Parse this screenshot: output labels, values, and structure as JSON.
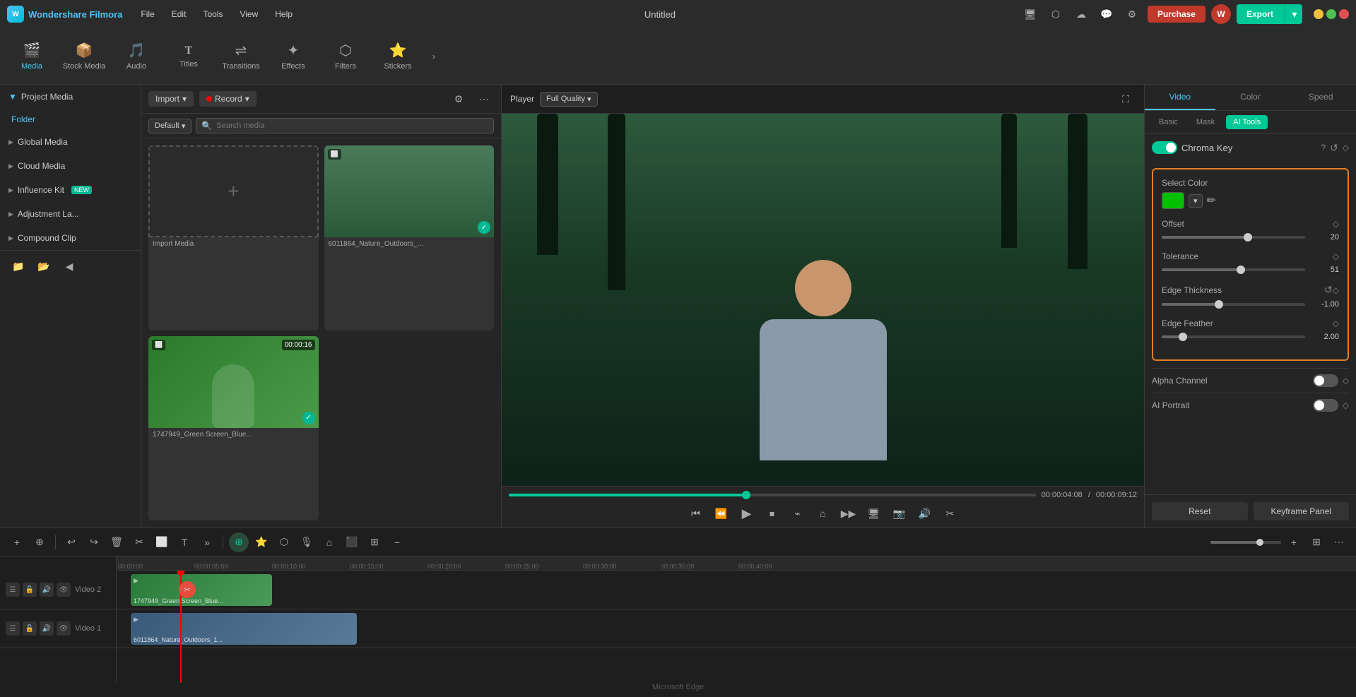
{
  "app": {
    "name": "Wondershare Filmora",
    "title": "Untitled"
  },
  "titlebar": {
    "menu": [
      "File",
      "Edit",
      "Tools",
      "View",
      "Help"
    ],
    "purchase_label": "Purchase",
    "export_label": "Export",
    "avatar_initials": "W"
  },
  "toolbar": {
    "items": [
      {
        "id": "media",
        "label": "Media",
        "icon": "🎬"
      },
      {
        "id": "stock",
        "label": "Stock Media",
        "icon": "📦"
      },
      {
        "id": "audio",
        "label": "Audio",
        "icon": "🎵"
      },
      {
        "id": "titles",
        "label": "Titles",
        "icon": "T"
      },
      {
        "id": "transitions",
        "label": "Transitions",
        "icon": "↔"
      },
      {
        "id": "effects",
        "label": "Effects",
        "icon": "✦"
      },
      {
        "id": "filters",
        "label": "Filters",
        "icon": "⬡"
      },
      {
        "id": "stickers",
        "label": "Stickers",
        "icon": "⭐"
      }
    ]
  },
  "sidebar": {
    "items": [
      {
        "id": "project-media",
        "label": "Project Media",
        "has_chevron": true
      },
      {
        "id": "folder",
        "label": "Folder",
        "type": "folder"
      },
      {
        "id": "global-media",
        "label": "Global Media",
        "has_chevron": true
      },
      {
        "id": "cloud-media",
        "label": "Cloud Media",
        "has_chevron": true
      },
      {
        "id": "influence-kit",
        "label": "Influence Kit",
        "badge": "NEW",
        "has_chevron": true
      },
      {
        "id": "adjustment-layer",
        "label": "Adjustment La...",
        "has_chevron": true
      },
      {
        "id": "compound-clip",
        "label": "Compound Clip",
        "has_chevron": true
      }
    ]
  },
  "media_panel": {
    "import_label": "Import",
    "record_label": "Record",
    "default_label": "Default",
    "search_placeholder": "Search media",
    "items": [
      {
        "id": "import-media",
        "label": "Import Media",
        "type": "add"
      },
      {
        "id": "nature",
        "label": "6011864_Nature_Outdoors_...",
        "type": "nature",
        "checked": true
      },
      {
        "id": "green-screen",
        "label": "1747949_Green Screen_Blue...",
        "type": "green-screen",
        "duration": "00:00:16",
        "checked": true
      }
    ]
  },
  "player": {
    "label": "Player",
    "quality": "Full Quality",
    "time_current": "00:00:04:08",
    "time_total": "00:00:09:12",
    "progress_pct": 45
  },
  "right_panel": {
    "tabs": [
      "Video",
      "Color",
      "Speed"
    ],
    "active_tab": "Video",
    "sub_tabs": [
      "Basic",
      "Mask",
      "AI Tools"
    ],
    "active_sub_tab": "AI Tools",
    "chroma_key": {
      "label": "Chroma Key",
      "enabled": true
    },
    "select_color": {
      "label": "Select Color",
      "color": "#00c000"
    },
    "offset": {
      "label": "Offset",
      "value": "20",
      "pct": 60
    },
    "tolerance": {
      "label": "Tolerance",
      "value": "51",
      "pct": 55
    },
    "edge_thickness": {
      "label": "Edge Thickness",
      "value": "-1.00",
      "pct": 40
    },
    "edge_feather": {
      "label": "Edge Feather",
      "value": "2.00",
      "pct": 15
    },
    "alpha_channel": {
      "label": "Alpha Channel",
      "enabled": false
    },
    "ai_portrait": {
      "label": "AI Portrait",
      "enabled": false
    },
    "reset_label": "Reset",
    "keyframe_panel_label": "Keyframe Panel"
  },
  "timeline": {
    "tracks": [
      {
        "id": "video2",
        "label": "Video 2"
      },
      {
        "id": "video1",
        "label": "Video 1"
      }
    ],
    "clips": [
      {
        "track": 0,
        "label": "1747949_Green Screen_Blue...",
        "file": "🎬"
      },
      {
        "track": 1,
        "label": "6011864_Nature_Outdoors_1...",
        "file": "🎬"
      }
    ],
    "markers": [
      "00:00:00",
      "00:00:05:00",
      "00:00:10:00",
      "00:00:15:00",
      "00:00:20:00",
      "00:00:25:00",
      "00:00:30:00",
      "00:00:35:00",
      "00:00:40:00"
    ]
  },
  "edge_label": "Microsoft Edge"
}
